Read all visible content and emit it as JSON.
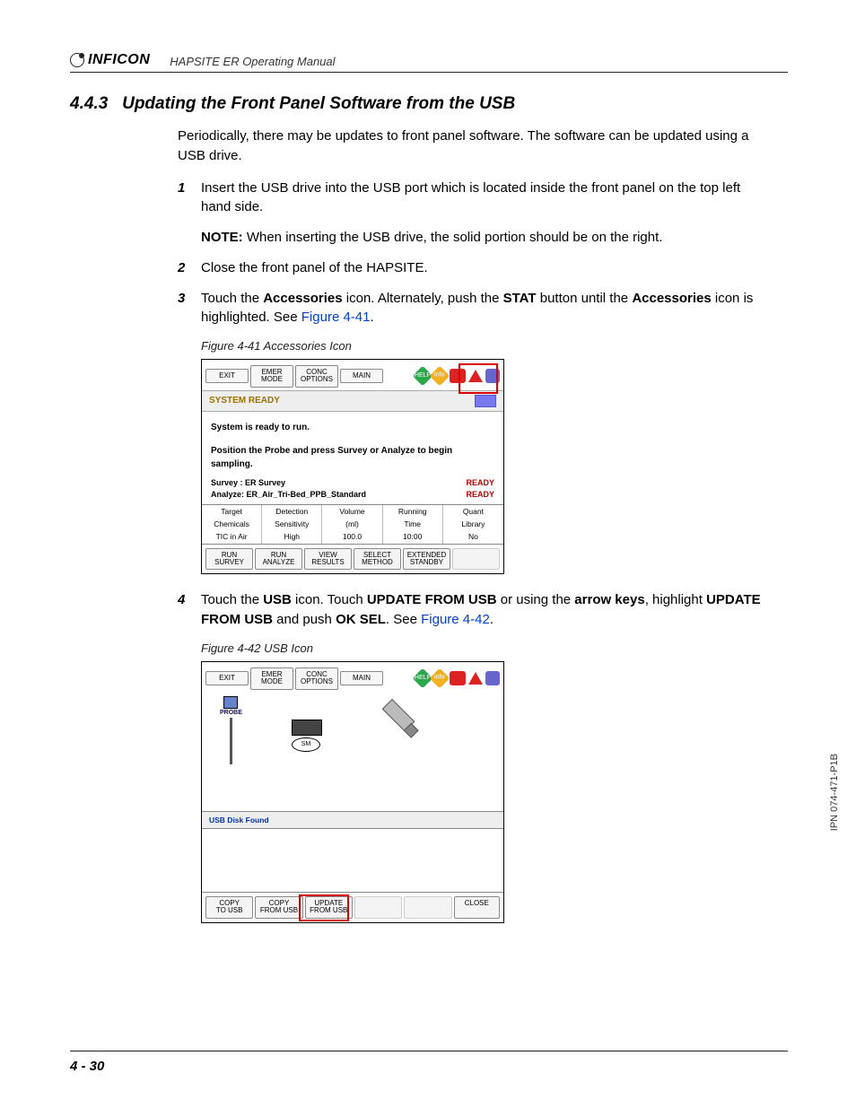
{
  "header": {
    "brand": "INFICON",
    "doc_title": "HAPSITE ER Operating Manual"
  },
  "section": {
    "number": "4.4.3",
    "title": "Updating the Front Panel Software from the USB"
  },
  "intro": "Periodically, there may be updates to front panel software. The software can be updated using a USB drive.",
  "steps": {
    "s1": {
      "num": "1",
      "text_a": "Insert the USB drive into the USB port which is located inside the front panel on the top left hand side."
    },
    "note1": {
      "label": "NOTE:",
      "text": "When inserting the USB drive, the solid portion should be on the right."
    },
    "s2": {
      "num": "2",
      "text": "Close the front panel of the HAPSITE."
    },
    "s3": {
      "num": "3",
      "t1": "Touch the ",
      "b1": "Accessories",
      "t2": " icon. Alternately, push the ",
      "b2": "STAT",
      "t3": " button until the ",
      "b3": "Accessories",
      "t4": " icon is highlighted. See ",
      "link": "Figure 4-41",
      "t5": "."
    },
    "s4": {
      "num": "4",
      "t1": "Touch the ",
      "b1": "USB",
      "t2": " icon. Touch ",
      "b2": "UPDATE FROM USB",
      "t3": " or using the ",
      "b3": "arrow keys",
      "t4": ", highlight ",
      "b4": "UPDATE FROM USB",
      "t5": " and push ",
      "b5": "OK SEL",
      "t6": ". See ",
      "link": "Figure 4-42",
      "t7": "."
    }
  },
  "fig41": {
    "caption": "Figure 4-41  Accessories Icon",
    "toolbar": {
      "exit": "EXIT",
      "emer": "EMER\nMODE",
      "conc": "CONC\nOPTIONS",
      "main": "MAIN"
    },
    "icons": {
      "help": "HELP",
      "info": "info"
    },
    "sys_ready": "SYSTEM READY",
    "msg1": "System is ready to run.",
    "msg2": "Position the Probe and press Survey or Analyze to begin sampling.",
    "survey_label": "Survey : ER Survey",
    "analyze_label": "Analyze: ER_Air_Tri-Bed_PPB_Standard",
    "ready": "READY",
    "grid": {
      "h": [
        "Target",
        "Detection",
        "Volume",
        "Running",
        "Quant"
      ],
      "r1": [
        "Chemicals",
        "Sensitivity",
        "(ml)",
        "Time",
        "Library"
      ],
      "r2": [
        "TIC in Air",
        "High",
        "100.0",
        "10:00",
        "No"
      ]
    },
    "bottom": {
      "b1": "RUN\nSURVEY",
      "b2": "RUN\nANALYZE",
      "b3": "VIEW\nRESULTS",
      "b4": "SELECT\nMETHOD",
      "b5": "EXTENDED\nSTANDBY"
    }
  },
  "fig42": {
    "caption": "Figure 4-42  USB Icon",
    "toolbar": {
      "exit": "EXIT",
      "emer": "EMER\nMODE",
      "conc": "CONC\nOPTIONS",
      "main": "MAIN"
    },
    "probe_label": "PROBE",
    "sm_label": "SM",
    "usb_found": "USB Disk Found",
    "bottom": {
      "b1": "COPY\nTO USB",
      "b2": "COPY\nFROM USB",
      "b3": "UPDATE\nFROM USB",
      "close": "CLOSE"
    }
  },
  "footer": {
    "pagenum": "4 - 30"
  },
  "ipn": "IPN 074-471-P1B"
}
